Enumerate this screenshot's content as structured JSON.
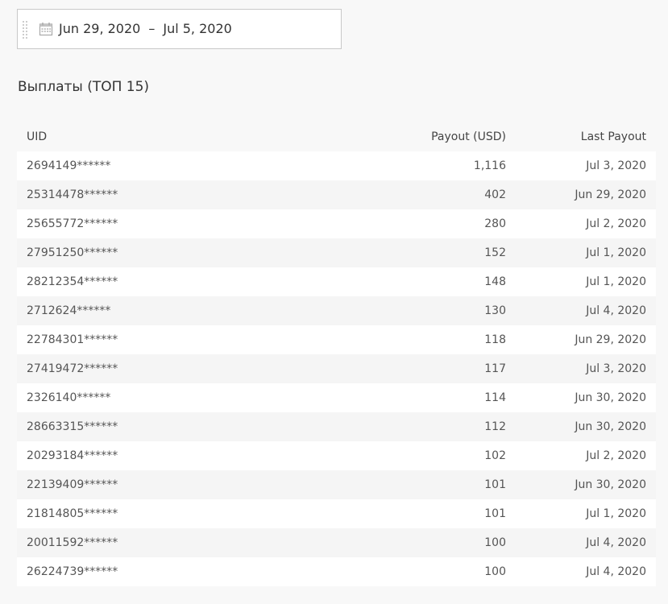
{
  "date_range": {
    "start": "Jun 29, 2020",
    "separator": "–",
    "end": "Jul 5, 2020"
  },
  "title": "Выплаты (ТОП 15)",
  "table": {
    "headers": {
      "uid": "UID",
      "payout": "Payout (USD)",
      "last_payout": "Last Payout"
    },
    "rows": [
      {
        "uid": "2694149******",
        "payout": "1,116",
        "last_payout": "Jul 3, 2020"
      },
      {
        "uid": "25314478******",
        "payout": "402",
        "last_payout": "Jun 29, 2020"
      },
      {
        "uid": "25655772******",
        "payout": "280",
        "last_payout": "Jul 2, 2020"
      },
      {
        "uid": "27951250******",
        "payout": "152",
        "last_payout": "Jul 1, 2020"
      },
      {
        "uid": "28212354******",
        "payout": "148",
        "last_payout": "Jul 1, 2020"
      },
      {
        "uid": "2712624******",
        "payout": "130",
        "last_payout": "Jul 4, 2020"
      },
      {
        "uid": "22784301******",
        "payout": "118",
        "last_payout": "Jun 29, 2020"
      },
      {
        "uid": "27419472******",
        "payout": "117",
        "last_payout": "Jul 3, 2020"
      },
      {
        "uid": "2326140******",
        "payout": "114",
        "last_payout": "Jun 30, 2020"
      },
      {
        "uid": "28663315******",
        "payout": "112",
        "last_payout": "Jun 30, 2020"
      },
      {
        "uid": "20293184******",
        "payout": "102",
        "last_payout": "Jul 2, 2020"
      },
      {
        "uid": "22139409******",
        "payout": "101",
        "last_payout": "Jun 30, 2020"
      },
      {
        "uid": "21814805******",
        "payout": "101",
        "last_payout": "Jul 1, 2020"
      },
      {
        "uid": "20011592******",
        "payout": "100",
        "last_payout": "Jul 4, 2020"
      },
      {
        "uid": "26224739******",
        "payout": "100",
        "last_payout": "Jul 4, 2020"
      }
    ]
  },
  "icons": {
    "drag_handle": "drag-handle-icon",
    "calendar": "calendar-icon"
  },
  "colors": {
    "background": "#f8f8f8",
    "row_odd": "#ffffff",
    "row_even": "#f5f5f5",
    "border": "#c9c9c9",
    "text": "#444444"
  }
}
